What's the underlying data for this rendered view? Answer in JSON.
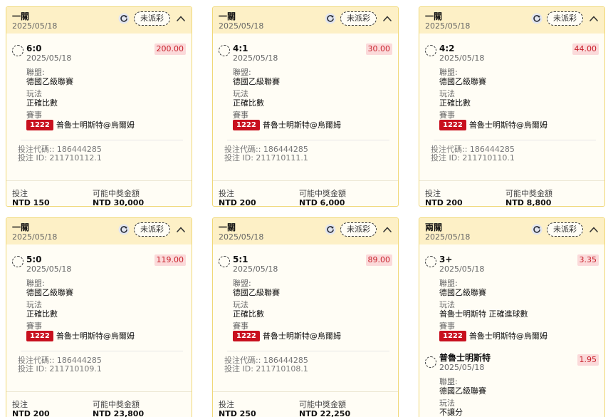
{
  "labels": {
    "league_label": "聯盟:",
    "market_label": "玩法",
    "event_label": "賽事",
    "code_prefix": "投注代碼:: ",
    "id_prefix": "投注 ID: ",
    "stake_label": "投注",
    "payout_label": "可能中獎金額"
  },
  "cards": [
    {
      "type": "一關",
      "date": "2025/05/18",
      "status": "未派彩",
      "selections": [
        {
          "name": "6:0",
          "date": "2025/05/18",
          "odds": "200.00",
          "league": "德國乙級聯賽",
          "market": "正確比數",
          "event_code": "1222",
          "event_name": "普魯士明斯特@烏爾姆"
        }
      ],
      "bet_code": "186444285",
      "bet_id": "211710112.1",
      "stake": "NTD 150",
      "payout": "NTD 30,000"
    },
    {
      "type": "一關",
      "date": "2025/05/18",
      "status": "未派彩",
      "selections": [
        {
          "name": "4:1",
          "date": "2025/05/18",
          "odds": "30.00",
          "league": "德國乙級聯賽",
          "market": "正確比數",
          "event_code": "1222",
          "event_name": "普魯士明斯特@烏爾姆"
        }
      ],
      "bet_code": "186444285",
      "bet_id": "211710111.1",
      "stake": "NTD 200",
      "payout": "NTD 6,000"
    },
    {
      "type": "一關",
      "date": "2025/05/18",
      "status": "未派彩",
      "selections": [
        {
          "name": "4:2",
          "date": "2025/05/18",
          "odds": "44.00",
          "league": "德國乙級聯賽",
          "market": "正確比數",
          "event_code": "1222",
          "event_name": "普魯士明斯特@烏爾姆"
        }
      ],
      "bet_code": "186444285",
      "bet_id": "211710110.1",
      "stake": "NTD 200",
      "payout": "NTD 8,800"
    },
    {
      "type": "一關",
      "date": "2025/05/18",
      "status": "未派彩",
      "selections": [
        {
          "name": "5:0",
          "date": "2025/05/18",
          "odds": "119.00",
          "league": "德國乙級聯賽",
          "market": "正確比數",
          "event_code": "1222",
          "event_name": "普魯士明斯特@烏爾姆"
        }
      ],
      "bet_code": "186444285",
      "bet_id": "211710109.1",
      "stake": "NTD 200",
      "payout": "NTD 23,800"
    },
    {
      "type": "一關",
      "date": "2025/05/18",
      "status": "未派彩",
      "selections": [
        {
          "name": "5:1",
          "date": "2025/05/18",
          "odds": "89.00",
          "league": "德國乙級聯賽",
          "market": "正確比數",
          "event_code": "1222",
          "event_name": "普魯士明斯特@烏爾姆"
        }
      ],
      "bet_code": "186444285",
      "bet_id": "211710108.1",
      "stake": "NTD 250",
      "payout": "NTD 22,250"
    },
    {
      "type": "兩關",
      "date": "2025/05/18",
      "status": "未派彩",
      "selections": [
        {
          "name": "3+",
          "date": "2025/05/18",
          "odds": "3.35",
          "league": "德國乙級聯賽",
          "market": "普魯士明斯特 正確進球數",
          "event_code": "1222",
          "event_name": "普魯士明斯特@烏爾姆"
        },
        {
          "name": "普魯士明斯特",
          "date": "2025/05/18",
          "odds": "1.95",
          "league": "德國乙級聯賽",
          "market": "不讓分"
        }
      ]
    }
  ],
  "colors": {
    "header_bg": "#fdf0c6",
    "card_border": "#f0d877",
    "odds_text": "#c8202a",
    "odds_bg": "#fbdada",
    "event_badge": "#c8101e"
  },
  "icons": {
    "refresh": "refresh-icon",
    "collapse": "chevron-up-icon",
    "pending": "dashed-circle-icon"
  }
}
